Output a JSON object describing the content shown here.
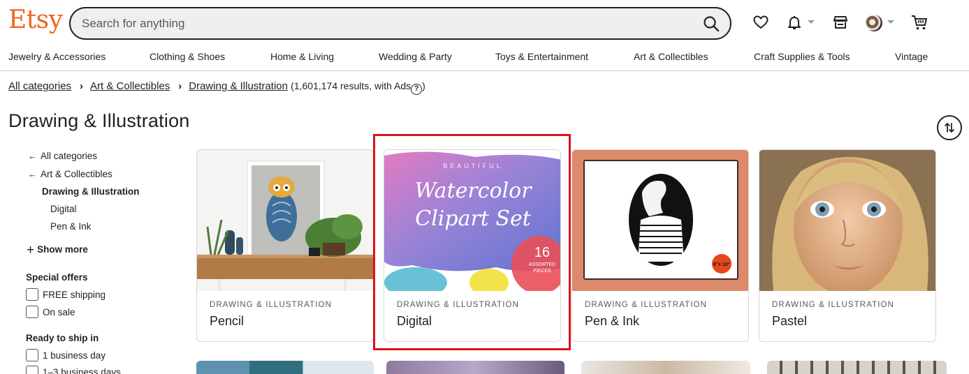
{
  "header": {
    "logo": "Etsy",
    "search_placeholder": "Search for anything"
  },
  "icons": {
    "search": "search-icon",
    "favorites": "heart-icon",
    "notifications": "bell-icon",
    "shop": "shop-icon",
    "account": "avatar",
    "cart": "cart-icon",
    "sort": "sort-arrows-icon"
  },
  "categories": [
    "Jewelry & Accessories",
    "Clothing & Shoes",
    "Home & Living",
    "Wedding & Party",
    "Toys & Entertainment",
    "Art & Collectibles",
    "Craft Supplies & Tools",
    "Vintage"
  ],
  "breadcrumb": {
    "items": [
      "All categories",
      "Art & Collectibles",
      "Drawing & Illustration"
    ],
    "meta_prefix": "(1,601,174 results, with Ads",
    "help": "?",
    "meta_suffix": ")"
  },
  "page": {
    "title": "Drawing & Illustration"
  },
  "sidebar": {
    "back_links": [
      "All categories",
      "Art & Collectibles"
    ],
    "current": "Drawing & Illustration",
    "subcategories": [
      "Digital",
      "Pen & Ink"
    ],
    "show_more": "Show more",
    "special_offers": {
      "heading": "Special offers",
      "options": [
        "FREE shipping",
        "On sale"
      ]
    },
    "ready_to_ship": {
      "heading": "Ready to ship in",
      "options": [
        "1 business day",
        "1–3 business days"
      ]
    }
  },
  "cards": [
    {
      "kicker": "DRAWING & ILLUSTRATION",
      "name": "Pencil"
    },
    {
      "kicker": "DRAWING & ILLUSTRATION",
      "name": "Digital",
      "image_text": {
        "top": "BEAUTIFUL",
        "line1": "Watercolor",
        "line2": "Clipart Set",
        "count": "16",
        "count_label1": "ASSORTED",
        "count_label2": "PIECES"
      }
    },
    {
      "kicker": "DRAWING & ILLUSTRATION",
      "name": "Pen & Ink",
      "image_text": {
        "badge": "8\"x 10\""
      }
    },
    {
      "kicker": "DRAWING & ILLUSTRATION",
      "name": "Pastel"
    }
  ],
  "colors": {
    "brand": "#f1641e",
    "highlight": "#d9131a",
    "text": "#222222"
  }
}
